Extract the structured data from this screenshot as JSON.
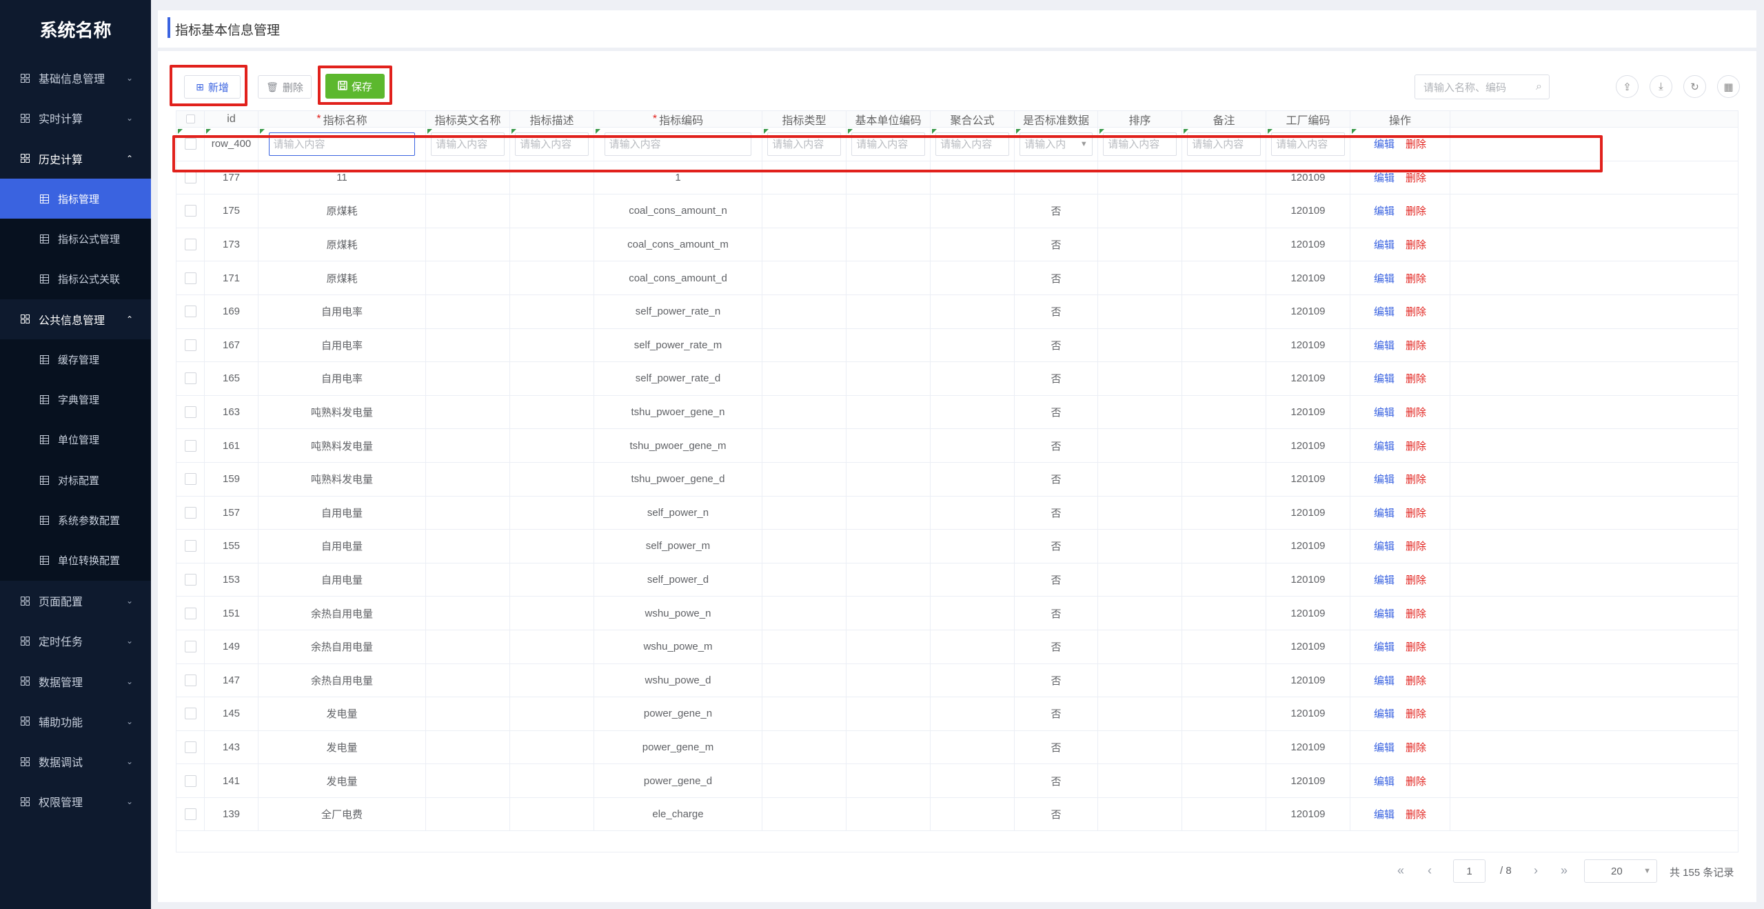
{
  "app": {
    "name": "系统名称"
  },
  "sidebar": {
    "top_items": [
      {
        "label": "基础信息管理",
        "chevron": "⌄"
      },
      {
        "label": "实时计算",
        "chevron": "⌄"
      },
      {
        "label": "历史计算",
        "chevron": "⌃"
      }
    ],
    "history_children": [
      {
        "label": "指标管理"
      },
      {
        "label": "指标公式管理"
      },
      {
        "label": "指标公式关联"
      }
    ],
    "public_item": {
      "label": "公共信息管理",
      "chevron": "⌃"
    },
    "public_children": [
      {
        "label": "缓存管理"
      },
      {
        "label": "字典管理"
      },
      {
        "label": "单位管理"
      },
      {
        "label": "对标配置"
      },
      {
        "label": "系统参数配置"
      },
      {
        "label": "单位转换配置"
      }
    ],
    "bottom_items": [
      {
        "label": "页面配置",
        "chevron": "⌄"
      },
      {
        "label": "定时任务",
        "chevron": "⌄"
      },
      {
        "label": "数据管理",
        "chevron": "⌄"
      },
      {
        "label": "辅助功能",
        "chevron": "⌄"
      },
      {
        "label": "数据调试",
        "chevron": "⌄"
      },
      {
        "label": "权限管理",
        "chevron": "⌄"
      }
    ]
  },
  "header": {
    "title": "指标基本信息管理"
  },
  "toolbar": {
    "add_label": "新增",
    "delete_label": "删除",
    "save_label": "保存",
    "search_placeholder": "请输入名称、编码"
  },
  "table": {
    "columns": [
      "id",
      "指标名称",
      "指标英文名称",
      "指标描述",
      "指标编码",
      "指标类型",
      "基本单位编码",
      "聚合公式",
      "是否标准数据",
      "排序",
      "备注",
      "工厂编码",
      "操作"
    ],
    "required_columns": [
      "指标名称",
      "指标编码"
    ],
    "required_mark": "*",
    "new_row": {
      "id": "row_400",
      "placeholder": "请输入内容",
      "dropdown_placeholder": "请输入内"
    },
    "edit_label": "编辑",
    "remove_label": "删除",
    "rows": [
      {
        "id": "177",
        "name": "11",
        "code": "1",
        "standard": "",
        "factory": "120109"
      },
      {
        "id": "175",
        "name": "原煤耗",
        "code": "coal_cons_amount_n",
        "standard": "否",
        "factory": "120109"
      },
      {
        "id": "173",
        "name": "原煤耗",
        "code": "coal_cons_amount_m",
        "standard": "否",
        "factory": "120109"
      },
      {
        "id": "171",
        "name": "原煤耗",
        "code": "coal_cons_amount_d",
        "standard": "否",
        "factory": "120109"
      },
      {
        "id": "169",
        "name": "自用电率",
        "code": "self_power_rate_n",
        "standard": "否",
        "factory": "120109"
      },
      {
        "id": "167",
        "name": "自用电率",
        "code": "self_power_rate_m",
        "standard": "否",
        "factory": "120109"
      },
      {
        "id": "165",
        "name": "自用电率",
        "code": "self_power_rate_d",
        "standard": "否",
        "factory": "120109"
      },
      {
        "id": "163",
        "name": "吨熟料发电量",
        "code": "tshu_pwoer_gene_n",
        "standard": "否",
        "factory": "120109"
      },
      {
        "id": "161",
        "name": "吨熟料发电量",
        "code": "tshu_pwoer_gene_m",
        "standard": "否",
        "factory": "120109"
      },
      {
        "id": "159",
        "name": "吨熟料发电量",
        "code": "tshu_pwoer_gene_d",
        "standard": "否",
        "factory": "120109"
      },
      {
        "id": "157",
        "name": "自用电量",
        "code": "self_power_n",
        "standard": "否",
        "factory": "120109"
      },
      {
        "id": "155",
        "name": "自用电量",
        "code": "self_power_m",
        "standard": "否",
        "factory": "120109"
      },
      {
        "id": "153",
        "name": "自用电量",
        "code": "self_power_d",
        "standard": "否",
        "factory": "120109"
      },
      {
        "id": "151",
        "name": "余热自用电量",
        "code": "wshu_powe_n",
        "standard": "否",
        "factory": "120109"
      },
      {
        "id": "149",
        "name": "余热自用电量",
        "code": "wshu_powe_m",
        "standard": "否",
        "factory": "120109"
      },
      {
        "id": "147",
        "name": "余热自用电量",
        "code": "wshu_powe_d",
        "standard": "否",
        "factory": "120109"
      },
      {
        "id": "145",
        "name": "发电量",
        "code": "power_gene_n",
        "standard": "否",
        "factory": "120109"
      },
      {
        "id": "143",
        "name": "发电量",
        "code": "power_gene_m",
        "standard": "否",
        "factory": "120109"
      },
      {
        "id": "141",
        "name": "发电量",
        "code": "power_gene_d",
        "standard": "否",
        "factory": "120109"
      },
      {
        "id": "139",
        "name": "全厂电费",
        "code": "ele_charge",
        "standard": "否",
        "factory": "120109"
      }
    ]
  },
  "pagination": {
    "current_page": "1",
    "total_pages": "/ 8",
    "page_size": "20",
    "total_text": "共 155 条记录"
  },
  "colors": {
    "accent": "#3a63e0",
    "danger": "#e1211c",
    "save": "#5cb82e",
    "sidebar_bg": "#0e1a2e"
  }
}
